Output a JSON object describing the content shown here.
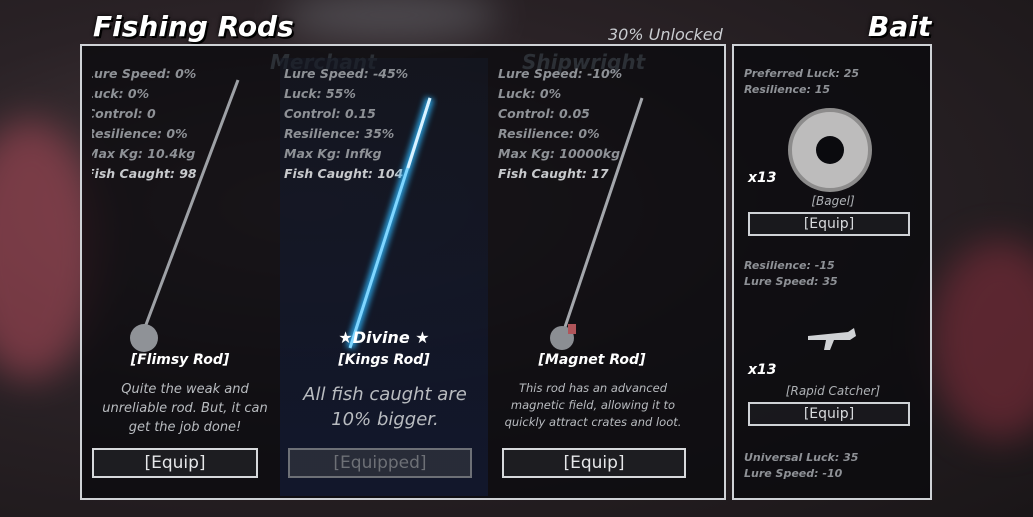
{
  "header": {
    "title": "Fishing Rods",
    "unlocked": "30% Unlocked",
    "bait_title": "Bait",
    "npc_labels": [
      "Merchant",
      "Shipwright"
    ]
  },
  "rods": [
    {
      "stats": [
        "Lure Speed: 0%",
        "Luck: 0%",
        "Control: 0",
        "Resilience: 0%",
        "Max Kg: 10.4kg",
        "Fish Caught: 98"
      ],
      "name": "[Flimsy Rod]",
      "description": "Quite the weak and unreliable rod. But, it can get the job done!",
      "button": "[Equip]"
    },
    {
      "stats": [
        "Lure Speed: -45%",
        "Luck: 55%",
        "Control: 0.15",
        "Resilience: 35%",
        "Max Kg: Infkg",
        "Fish Caught: 104"
      ],
      "rarity": "★Divine ★",
      "name": "[Kings Rod]",
      "description": "All fish caught are 10% bigger.",
      "button": "[Equipped]"
    },
    {
      "stats": [
        "Lure Speed: -10%",
        "Luck: 0%",
        "Control: 0.05",
        "Resilience: 0%",
        "Max Kg: 10000kg",
        "Fish Caught: 17"
      ],
      "name": "[Magnet Rod]",
      "description": "This rod has an advanced magnetic field, allowing it to quickly attract crates and loot.",
      "button": "[Equip]"
    }
  ],
  "baits": [
    {
      "stats": [
        "Preferred Luck: 25",
        "Resilience: 15"
      ],
      "count": "x13",
      "name": "[Bagel]",
      "button": "[Equip]"
    },
    {
      "stats": [
        "Resilience: -15",
        "Lure Speed: 35"
      ],
      "count": "x13",
      "name": "[Rapid Catcher]",
      "button": "[Equip]"
    },
    {
      "stats": [
        "Universal Luck: 35",
        "Lure Speed: -10"
      ]
    }
  ],
  "colors": {
    "panel_border": "#cfd2d6",
    "divine_glow": "#2fb8ff",
    "text_muted": "#8e9196"
  }
}
